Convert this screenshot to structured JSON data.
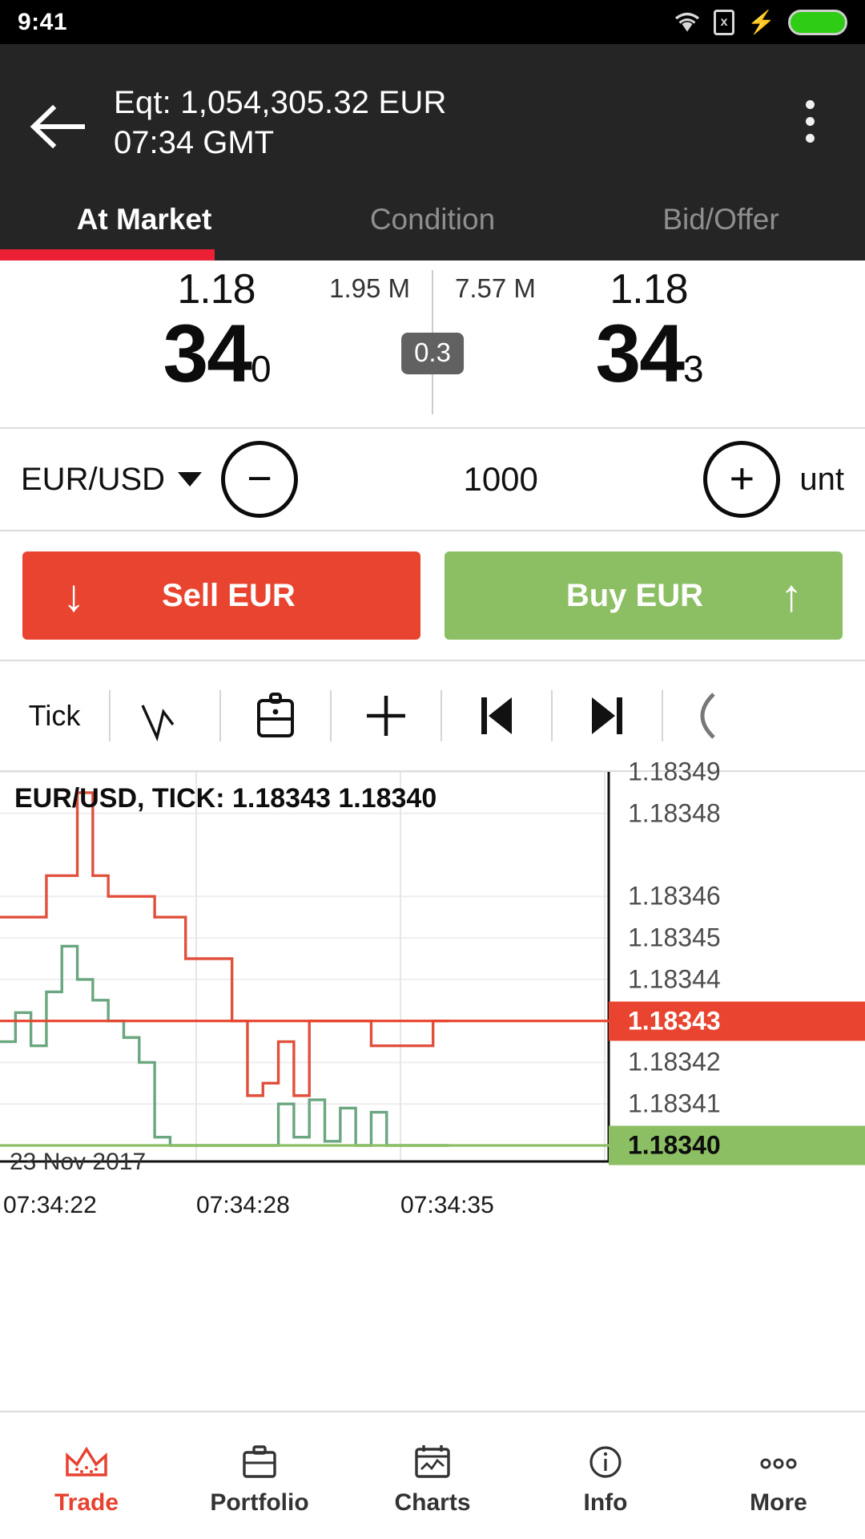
{
  "status_bar": {
    "time": "9:41",
    "icons": [
      "wifi-icon",
      "sim-x-icon",
      "charging-bolt-icon",
      "battery-icon"
    ],
    "battery_color": "#2ecc14"
  },
  "header": {
    "back_icon": "back-arrow-icon",
    "equity_line": "Eqt: 1,054,305.32 EUR",
    "time_line": "07:34 GMT",
    "overflow_icon": "kebab-menu-icon",
    "background": "#252525"
  },
  "tabs": {
    "items": [
      {
        "label": "At Market",
        "active": true
      },
      {
        "label": "Condition",
        "active": false
      },
      {
        "label": "Bid/Offer",
        "active": false
      }
    ],
    "indicator_color": "#ec2035"
  },
  "quote": {
    "bid": {
      "prefix": "1.18",
      "big": "34",
      "sub": "0",
      "volume": "1.95 M"
    },
    "ask": {
      "prefix": "1.18",
      "big": "34",
      "sub": "3",
      "volume": "7.57 M"
    },
    "spread": "0.3"
  },
  "order": {
    "symbol": "EUR/USD",
    "symbol_caret": "chevron-down-icon",
    "decrement": "−",
    "increment": "+",
    "quantity": "1000",
    "unit_label": "unt"
  },
  "trade_buttons": {
    "sell": {
      "label": "Sell EUR",
      "arrow": "↓",
      "color": "#e8442f"
    },
    "buy": {
      "label": "Buy EUR",
      "arrow": "↑",
      "color": "#8cbf63"
    }
  },
  "chart_toolbar": {
    "items": [
      {
        "label": "Tick",
        "icon": "tick-timeframe-label"
      },
      {
        "label": "",
        "icon": "line-chart-icon"
      },
      {
        "label": "",
        "icon": "briefcase-icon"
      },
      {
        "label": "",
        "icon": "crosshair-plus-icon"
      },
      {
        "label": "",
        "icon": "skip-back-icon"
      },
      {
        "label": "",
        "icon": "skip-forward-icon"
      },
      {
        "label": "",
        "icon": "refresh-circle-icon"
      }
    ]
  },
  "chart_data": {
    "type": "line",
    "title": "EUR/USD, TICK: 1.18343 1.18340",
    "date_label": "23 Nov 2017",
    "xlabel": "",
    "ylabel": "",
    "grid": true,
    "legend": "none",
    "ylim": [
      1.1834,
      1.18349
    ],
    "ytick_labels": [
      "1.18349",
      "1.18348",
      "1.18346",
      "1.18345",
      "1.18344",
      "1.18342",
      "1.18341"
    ],
    "yticks": [
      1.18349,
      1.18348,
      1.18346,
      1.18345,
      1.18344,
      1.18342,
      1.18341
    ],
    "price_tags": [
      {
        "value": "1.18343",
        "series": "ask",
        "color": "#e8442f"
      },
      {
        "value": "1.18340",
        "series": "bid",
        "color": "#8cbf63"
      }
    ],
    "xtick_labels": [
      "07:34:22",
      "07:34:28",
      "07:34:35"
    ],
    "series": [
      {
        "name": "ask",
        "color": "#e0503c",
        "values": [
          1.183455,
          1.183455,
          1.183455,
          1.183465,
          1.183465,
          1.183485,
          1.183465,
          1.18346,
          1.18346,
          1.18346,
          1.183455,
          1.183455,
          1.183445,
          1.183445,
          1.183445,
          1.18343,
          1.183412,
          1.183415,
          1.183425,
          1.183412,
          1.18343,
          1.18343,
          1.18343,
          1.18343,
          1.183424,
          1.183424,
          1.183424,
          1.183424,
          1.18343,
          1.18343
        ]
      },
      {
        "name": "bid",
        "color": "#6aa67f",
        "values": [
          1.183425,
          1.183432,
          1.183424,
          1.183437,
          1.183448,
          1.18344,
          1.183435,
          1.18343,
          1.183426,
          1.18342,
          1.183402,
          1.1834,
          1.1834,
          1.1834,
          1.1834,
          1.1834,
          1.1834,
          1.1834,
          1.18341,
          1.183402,
          1.183411,
          1.183401,
          1.183409,
          1.1834,
          1.183408,
          1.1834,
          1.1834,
          1.1834,
          1.1834,
          1.1834
        ]
      }
    ]
  },
  "bottom_nav": {
    "items": [
      {
        "label": "Trade",
        "icon": "trade-crown-icon",
        "active": true
      },
      {
        "label": "Portfolio",
        "icon": "briefcase-icon",
        "active": false
      },
      {
        "label": "Charts",
        "icon": "chart-calendar-icon",
        "active": false
      },
      {
        "label": "Info",
        "icon": "info-circle-icon",
        "active": false
      },
      {
        "label": "More",
        "icon": "more-dots-icon",
        "active": false
      }
    ],
    "active_color": "#e8412f"
  }
}
